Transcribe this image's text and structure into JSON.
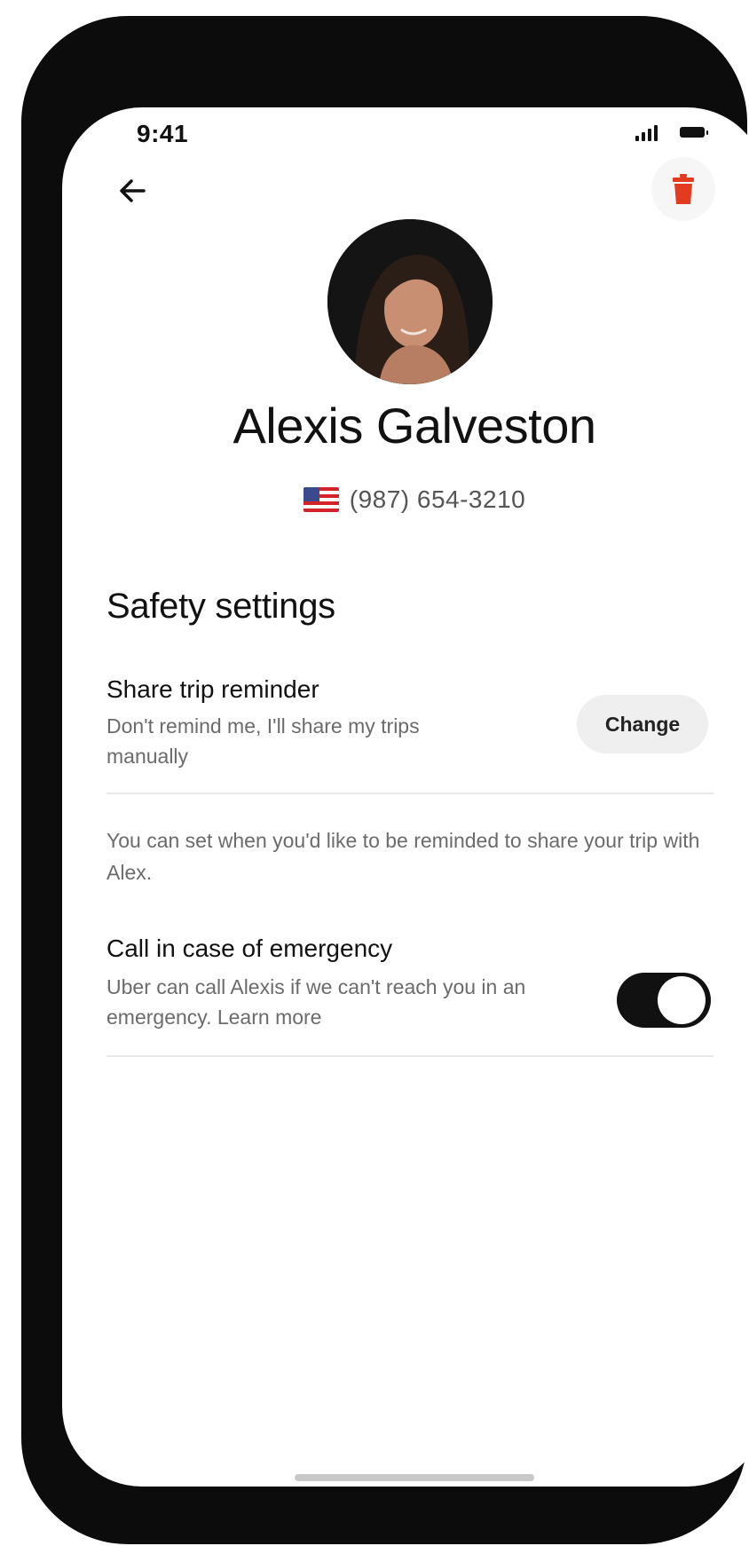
{
  "status_bar": {
    "time": "9:41"
  },
  "icons": {
    "back": "arrow-left-icon",
    "delete": "trash-icon",
    "flag": "us-flag-icon",
    "signal": "cellular-signal-icon",
    "battery": "battery-icon"
  },
  "contact": {
    "name": "Alexis Galveston",
    "phone": "(987) 654-3210"
  },
  "safety": {
    "title": "Safety settings",
    "share_trip": {
      "title": "Share trip reminder",
      "description": "Don't remind me, I'll share my trips manually",
      "button_label": "Change"
    },
    "note": "You can set when you'd like to be reminded to share your trip with Alex.",
    "emergency": {
      "title": "Call in case of emergency",
      "description": "Uber can call Alexis if we can't reach you in an emergency. Learn more",
      "toggle_on": true
    }
  },
  "colors": {
    "delete_icon": "#e23b1f",
    "toggle_on": "#111111",
    "frame": "#0c0c0c"
  }
}
